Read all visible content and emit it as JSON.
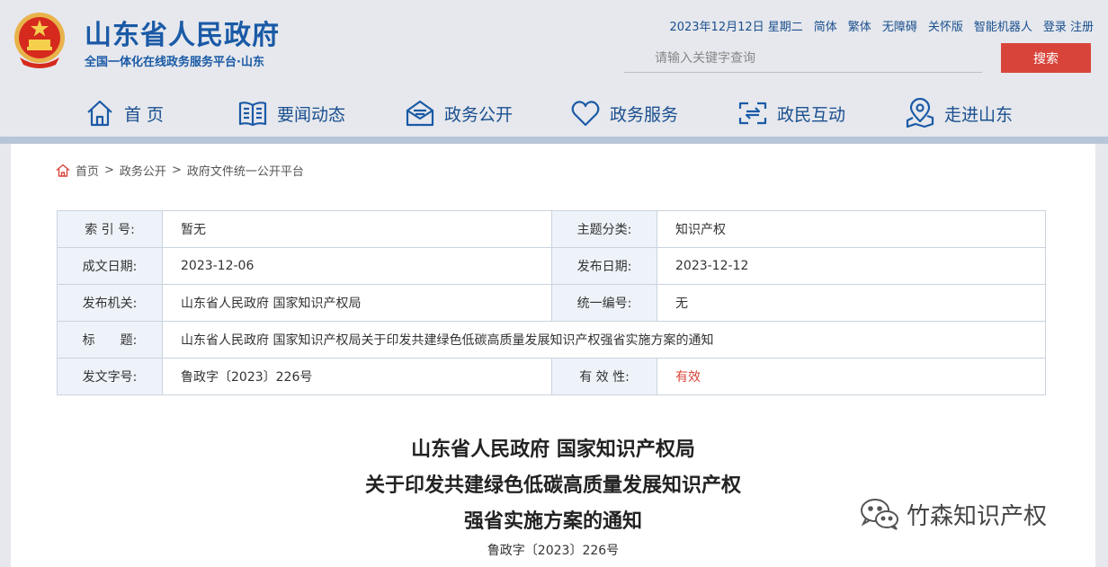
{
  "header": {
    "site_title": "山东省人民政府",
    "site_subtitle": "全国一体化在线政务服务平台·山东",
    "date": "2023年12月12日 星期二",
    "links": [
      "简体",
      "繁体",
      "无障碍",
      "关怀版",
      "智能机器人",
      "登录 注册"
    ],
    "search_placeholder": "请输入关键字查询",
    "search_button": "搜索"
  },
  "nav": [
    {
      "label": "首 页",
      "icon": "home-icon"
    },
    {
      "label": "要闻动态",
      "icon": "book-icon"
    },
    {
      "label": "政务公开",
      "icon": "mail-icon"
    },
    {
      "label": "政务服务",
      "icon": "heart-icon"
    },
    {
      "label": "政民互动",
      "icon": "interaction-icon"
    },
    {
      "label": "走进山东",
      "icon": "map-pin-icon"
    }
  ],
  "breadcrumb": [
    "首页",
    "政务公开",
    "政府文件统一公开平台"
  ],
  "meta": {
    "index_label": "索 引 号:",
    "index_value": "暂无",
    "topic_label": "主题分类:",
    "topic_value": "知识产权",
    "created_label": "成文日期:",
    "created_value": "2023-12-06",
    "published_label": "发布日期:",
    "published_value": "2023-12-12",
    "issuer_label": "发布机关:",
    "issuer_value": "山东省人民政府 国家知识产权局",
    "serial_label": "统一编号:",
    "serial_value": "无",
    "title_label": "标　　题:",
    "title_value": "山东省人民政府 国家知识产权局关于印发共建绿色低碳高质量发展知识产权强省实施方案的通知",
    "docno_label": "发文字号:",
    "docno_value": "鲁政字〔2023〕226号",
    "validity_label": "有 效 性:",
    "validity_value": "有效"
  },
  "document": {
    "title_lines": [
      "山东省人民政府 国家知识产权局",
      "关于印发共建绿色低碳高质量发展知识产权",
      "强省实施方案的通知"
    ],
    "doc_number": "鲁政字〔2023〕226号"
  },
  "watermark": {
    "text": "竹森知识产权",
    "icon": "wechat-icon"
  },
  "colors": {
    "brand_blue": "#1a5aa6",
    "accent_red": "#d9443a",
    "header_bg": "#e6e8ed",
    "label_bg": "#eef3f9"
  }
}
